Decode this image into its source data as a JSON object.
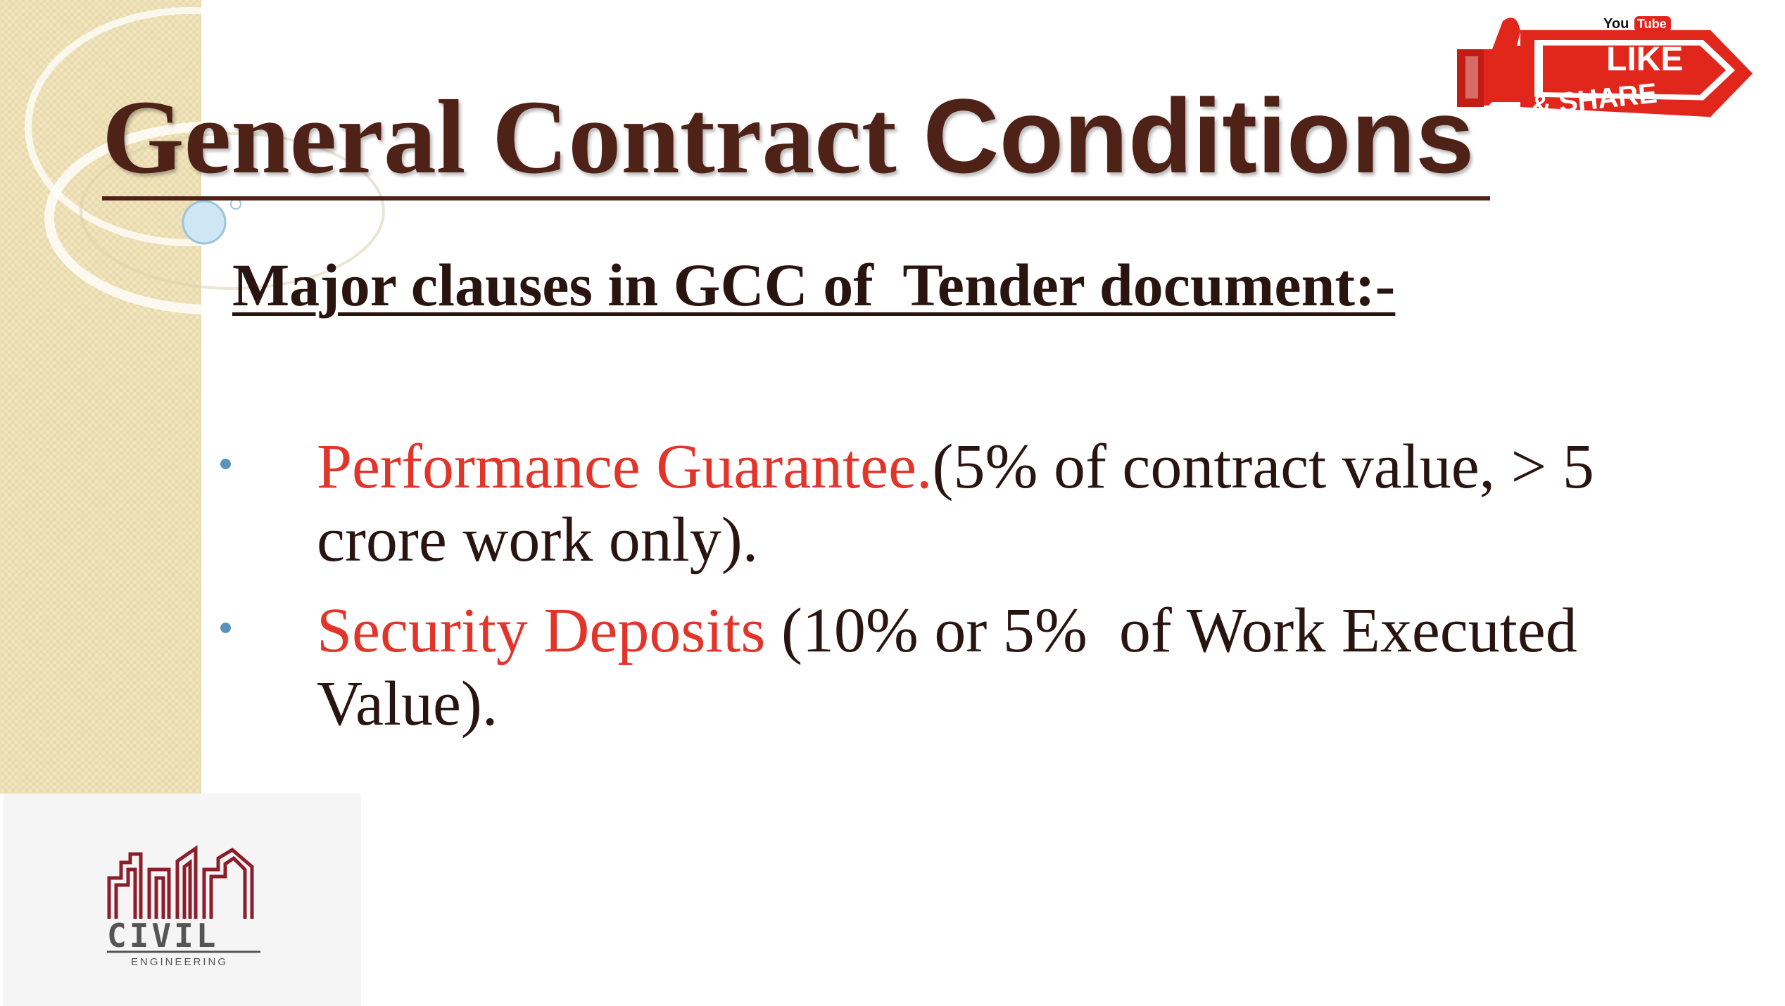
{
  "slide": {
    "title_part1": "General Contract ",
    "title_part2": "Conditions",
    "subtitle": "Major clauses in GCC of  Tender document:-",
    "bullets": [
      {
        "highlight": "Performance Guarantee.",
        "rest": "(5% of contract value, > 5 crore work only)."
      },
      {
        "highlight": "Security Deposits",
        "rest": " (10% or 5%  of Work Executed Value)."
      }
    ]
  },
  "badge": {
    "brand": "YouTube",
    "brand_you": "You",
    "brand_tube": "Tube",
    "line1": "LIKE",
    "line2": "& SHARE"
  },
  "logo": {
    "name": "CIVIL",
    "tagline": "ENGINEERING"
  },
  "colors": {
    "title": "#4f2218",
    "body_text": "#2a1410",
    "highlight": "#e3342a",
    "bullet": "#5a93ba",
    "badge_red": "#e1261c",
    "logo_red": "#8b1e2b",
    "logo_gray": "#555555"
  }
}
